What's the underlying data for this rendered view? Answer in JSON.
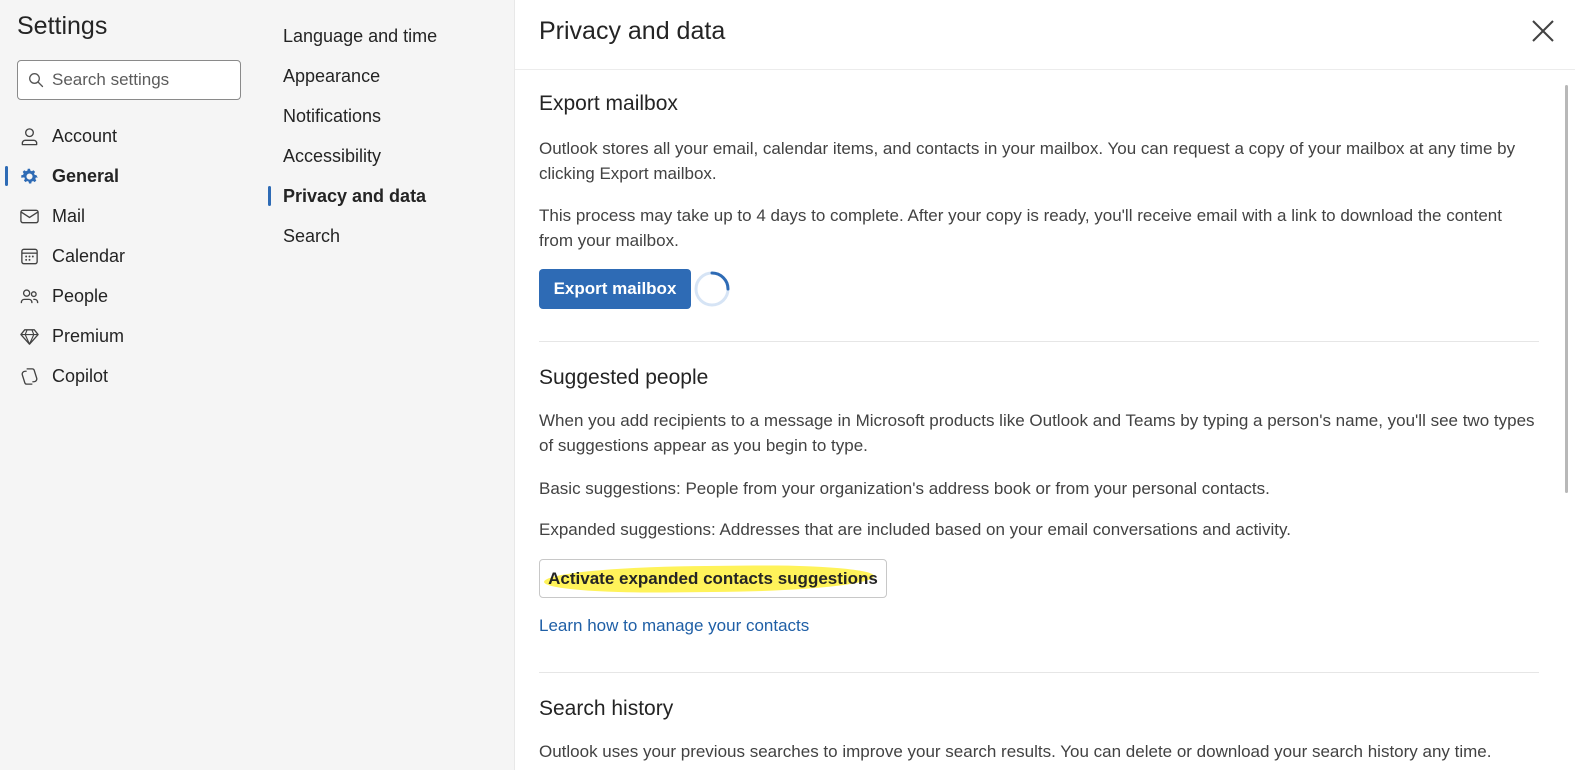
{
  "sidebar": {
    "title": "Settings",
    "search_placeholder": "Search settings",
    "items": [
      {
        "label": "Account",
        "icon": "person-icon"
      },
      {
        "label": "General",
        "icon": "gear-icon"
      },
      {
        "label": "Mail",
        "icon": "mail-icon"
      },
      {
        "label": "Calendar",
        "icon": "calendar-icon"
      },
      {
        "label": "People",
        "icon": "people-icon"
      },
      {
        "label": "Premium",
        "icon": "diamond-icon"
      },
      {
        "label": "Copilot",
        "icon": "copilot-icon"
      }
    ],
    "active": "General"
  },
  "subnav": {
    "items": [
      {
        "label": "Language and time"
      },
      {
        "label": "Appearance"
      },
      {
        "label": "Notifications"
      },
      {
        "label": "Accessibility"
      },
      {
        "label": "Privacy and data"
      },
      {
        "label": "Search"
      }
    ],
    "active": "Privacy and data"
  },
  "main": {
    "title": "Privacy and data",
    "export": {
      "title": "Export mailbox",
      "p1": "Outlook stores all your email, calendar items, and contacts in your mailbox. You can request a copy of your mailbox at any time by clicking Export mailbox.",
      "p2": "This process may take up to 4 days to complete. After your copy is ready, you'll receive email with a link to download the content from your mailbox.",
      "button": "Export mailbox"
    },
    "suggested": {
      "title": "Suggested people",
      "p1": "When you add recipients to a message in Microsoft products like Outlook and Teams by typing a person's name, you'll see two types of suggestions appear as you begin to type.",
      "p2": "Basic suggestions: People from your organization's address book or from your personal contacts.",
      "p3": "Expanded suggestions: Addresses that are included based on your email conversations and activity.",
      "button": "Activate expanded contacts suggestions",
      "link": "Learn how to manage your contacts"
    },
    "history": {
      "title": "Search history",
      "p1": "Outlook uses your previous searches to improve your search results. You can delete or download your search history any time."
    }
  },
  "colors": {
    "accent": "#2e6bb5",
    "link": "#1f5fa6",
    "highlight": "#fff35a",
    "sidebar_bg": "#f5f5f5"
  }
}
